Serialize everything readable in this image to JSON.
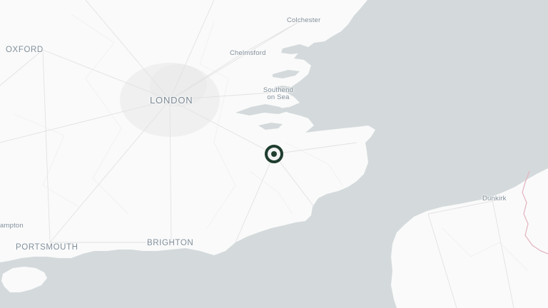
{
  "map": {
    "colors": {
      "water": "#d4dadc",
      "land": "#fafafa",
      "border": "#e4b7c2",
      "marker": "#1f3d2f"
    },
    "labels": {
      "colchester": "Colchester",
      "oxford": "OXFORD",
      "chelmsford": "Chelmsford",
      "london": "LONDON",
      "southend_line1": "Southend",
      "southend_line2": "on Sea",
      "dunkirk": "Dunkirk",
      "southampton": "ampton",
      "portsmouth": "PORTSMOUTH",
      "brighton": "BRIGHTON"
    },
    "marker": {
      "icon": "location-target-icon"
    }
  }
}
